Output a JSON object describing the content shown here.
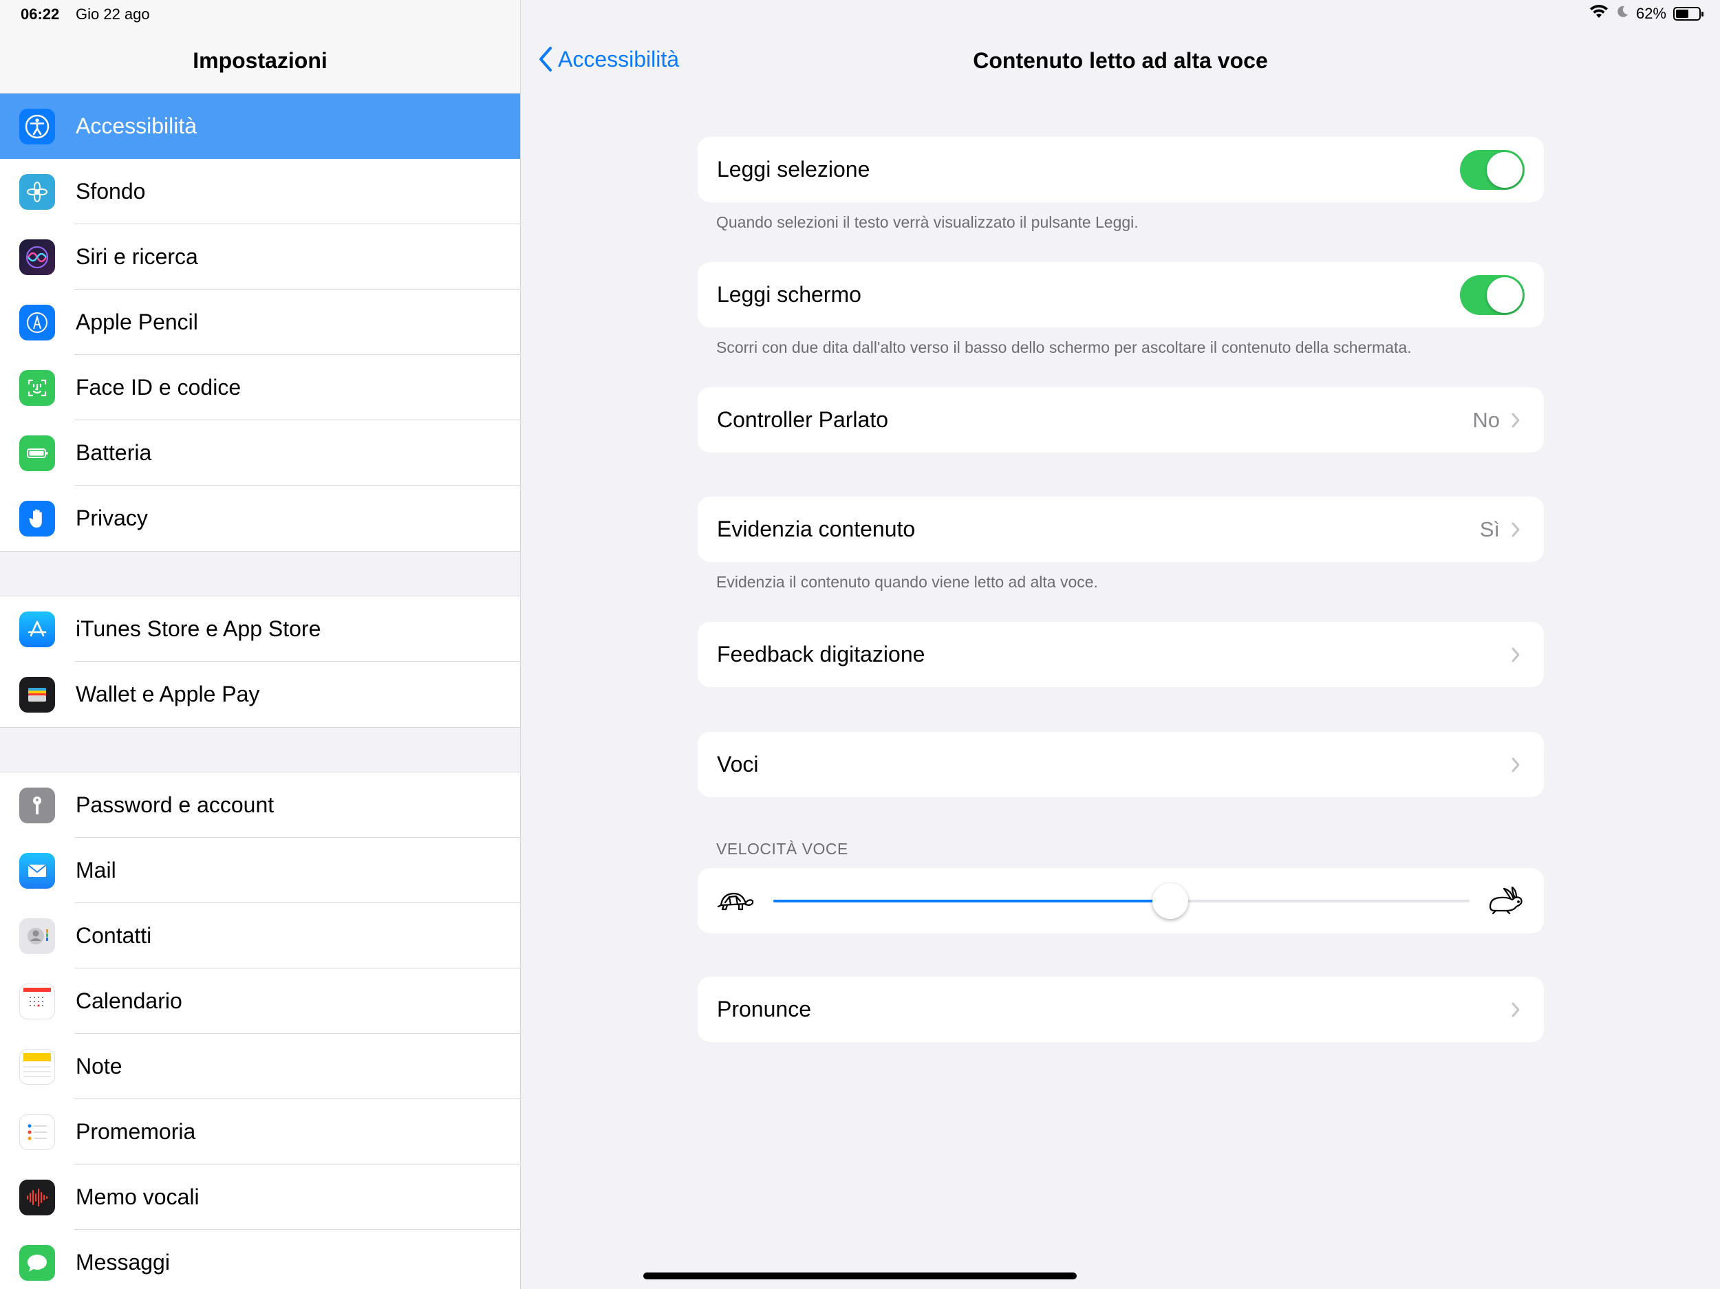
{
  "status_bar": {
    "time": "06:22",
    "date": "Gio 22 ago",
    "battery": "62%",
    "battery_level": 0.62
  },
  "sidebar": {
    "title": "Impostazioni",
    "groups": [
      [
        {
          "label": "Accessibilità",
          "icon": "accessibility-icon",
          "selected": true
        },
        {
          "label": "Sfondo",
          "icon": "wallpaper-icon"
        },
        {
          "label": "Siri e ricerca",
          "icon": "siri-icon"
        },
        {
          "label": "Apple Pencil",
          "icon": "pencil-icon"
        },
        {
          "label": "Face ID e codice",
          "icon": "faceid-icon"
        },
        {
          "label": "Batteria",
          "icon": "battery-icon"
        },
        {
          "label": "Privacy",
          "icon": "hand-icon"
        }
      ],
      [
        {
          "label": "iTunes Store e App Store",
          "icon": "app-store-icon"
        },
        {
          "label": "Wallet e Apple Pay",
          "icon": "wallet-icon"
        }
      ],
      [
        {
          "label": "Password e account",
          "icon": "key-icon"
        },
        {
          "label": "Mail",
          "icon": "mail-icon"
        },
        {
          "label": "Contatti",
          "icon": "contacts-icon"
        },
        {
          "label": "Calendario",
          "icon": "calendar-icon"
        },
        {
          "label": "Note",
          "icon": "notes-icon"
        },
        {
          "label": "Promemoria",
          "icon": "reminders-icon"
        },
        {
          "label": "Memo vocali",
          "icon": "voice-memos-icon"
        },
        {
          "label": "Messaggi",
          "icon": "messages-icon"
        }
      ]
    ]
  },
  "detail": {
    "back_label": "Accessibilità",
    "title": "Contenuto letto ad alta voce",
    "leggi_selezione": {
      "label": "Leggi selezione",
      "on": true,
      "footer": "Quando selezioni il testo verrà visualizzato il pulsante Leggi."
    },
    "leggi_schermo": {
      "label": "Leggi schermo",
      "on": true,
      "footer": "Scorri con due dita dall'alto verso il basso dello schermo per ascoltare il contenuto della schermata."
    },
    "controller_parlato": {
      "label": "Controller Parlato",
      "value": "No"
    },
    "evidenzia_contenuto": {
      "label": "Evidenzia contenuto",
      "value": "Sì",
      "footer": "Evidenzia il contenuto quando viene letto ad alta voce."
    },
    "feedback_digitazione": {
      "label": "Feedback digitazione"
    },
    "voci": {
      "label": "Voci"
    },
    "velocita_voce": {
      "header": "VELOCITÀ VOCE",
      "value": 0.57
    },
    "pronunce": {
      "label": "Pronunce"
    }
  },
  "colors": {
    "accent": "#0a7aff",
    "toggle_on": "#34c759",
    "selected_row": "#4a9cf7"
  }
}
